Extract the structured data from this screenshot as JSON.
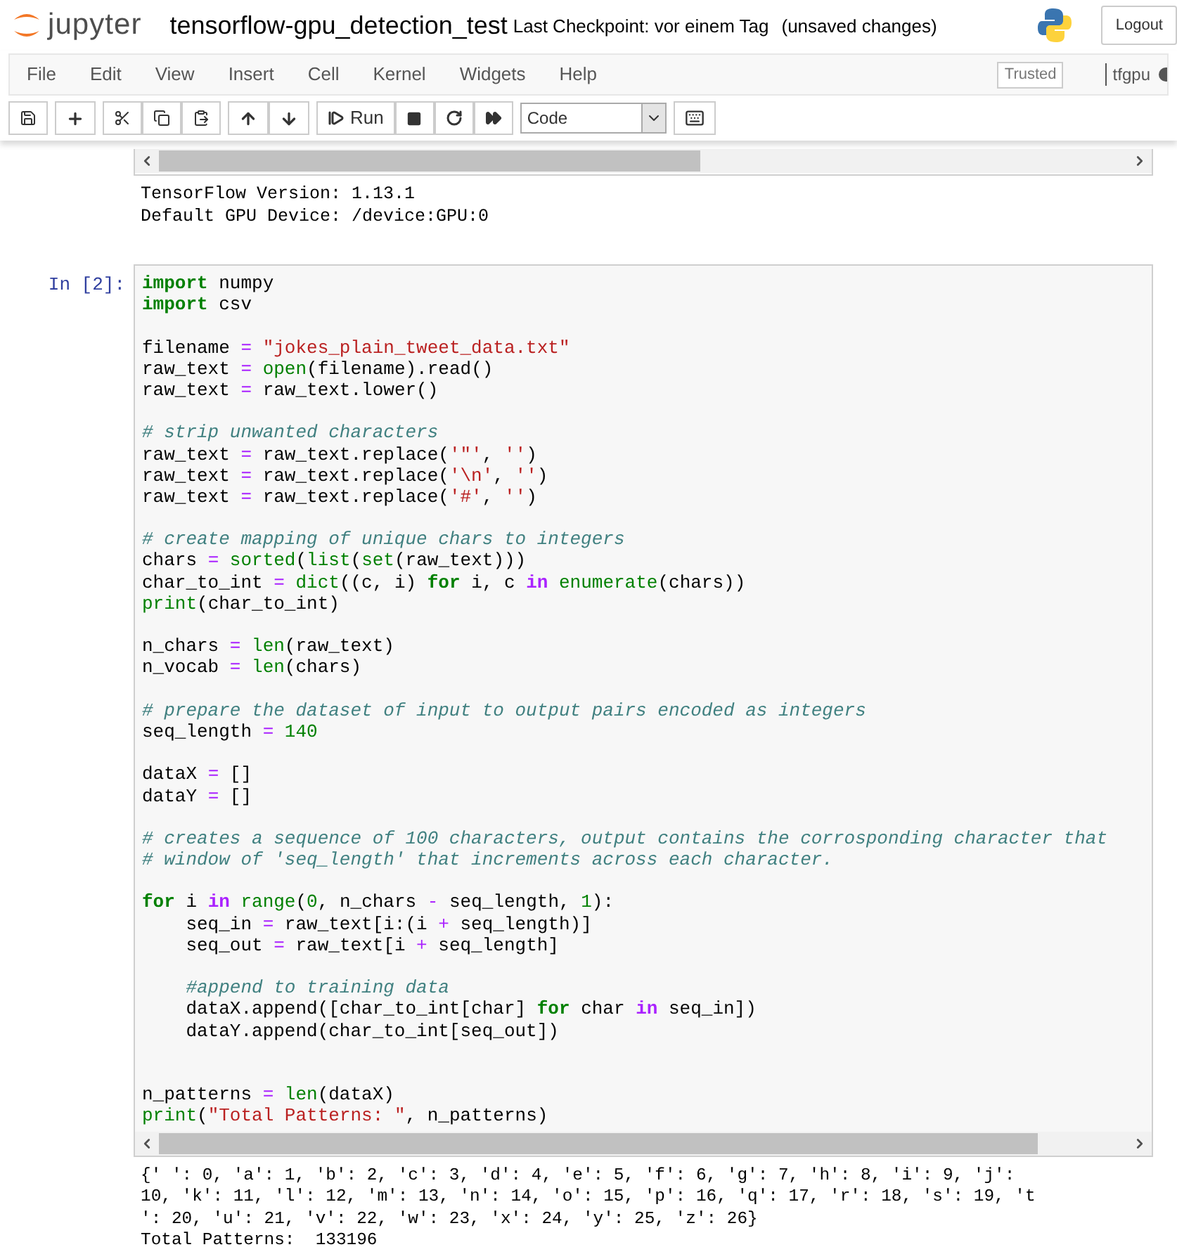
{
  "header": {
    "logo_text": "jupyter",
    "notebook_name": "tensorflow-gpu_detection_test",
    "checkpoint": "Last Checkpoint: vor einem Tag",
    "unsaved": "(unsaved changes)",
    "logout": "Logout"
  },
  "menubar": {
    "items": [
      "File",
      "Edit",
      "View",
      "Insert",
      "Cell",
      "Kernel",
      "Widgets",
      "Help"
    ],
    "trusted": "Trusted",
    "kernel_name": "tfgpu"
  },
  "toolbar": {
    "run_label": "Run",
    "cell_type": "Code"
  },
  "previous_output": [
    "TensorFlow Version: 1.13.1",
    "Default GPU Device: /device:GPU:0"
  ],
  "cell": {
    "prompt": "In [2]:",
    "blocks": [
      {
        "lines": [
          [
            {
              "kind": "kw",
              "text": "import"
            },
            {
              "kind": "plain",
              "text": " numpy"
            }
          ],
          [
            {
              "kind": "kw",
              "text": "import"
            },
            {
              "kind": "plain",
              "text": " csv"
            }
          ]
        ]
      },
      {
        "lines": [
          [
            {
              "kind": "plain",
              "text": "filename"
            },
            {
              "kind": "op",
              "text": " = "
            },
            {
              "kind": "str",
              "text": "\"jokes_plain_tweet_data.txt\""
            }
          ],
          [
            {
              "kind": "plain",
              "text": "raw_text"
            },
            {
              "kind": "op",
              "text": " = "
            },
            {
              "kind": "builtin",
              "text": "open"
            },
            {
              "kind": "plain",
              "text": "(filename).read()"
            }
          ],
          [
            {
              "kind": "plain",
              "text": "raw_text"
            },
            {
              "kind": "op",
              "text": " = "
            },
            {
              "kind": "plain",
              "text": "raw_text.lower()"
            }
          ]
        ]
      },
      {
        "lines": [
          [
            {
              "kind": "comment",
              "text": "# strip unwanted characters"
            }
          ],
          [
            {
              "kind": "plain",
              "text": "raw_text"
            },
            {
              "kind": "op",
              "text": " = "
            },
            {
              "kind": "plain",
              "text": "raw_text.replace("
            },
            {
              "kind": "str",
              "text": "'\"'"
            },
            {
              "kind": "plain",
              "text": ", "
            },
            {
              "kind": "str",
              "text": "''"
            },
            {
              "kind": "plain",
              "text": ")"
            }
          ],
          [
            {
              "kind": "plain",
              "text": "raw_text"
            },
            {
              "kind": "op",
              "text": " = "
            },
            {
              "kind": "plain",
              "text": "raw_text.replace("
            },
            {
              "kind": "str",
              "text": "'\\n'"
            },
            {
              "kind": "plain",
              "text": ", "
            },
            {
              "kind": "str",
              "text": "''"
            },
            {
              "kind": "plain",
              "text": ")"
            }
          ],
          [
            {
              "kind": "plain",
              "text": "raw_text"
            },
            {
              "kind": "op",
              "text": " = "
            },
            {
              "kind": "plain",
              "text": "raw_text.replace("
            },
            {
              "kind": "str",
              "text": "'#'"
            },
            {
              "kind": "plain",
              "text": ", "
            },
            {
              "kind": "str",
              "text": "''"
            },
            {
              "kind": "plain",
              "text": ")"
            }
          ]
        ]
      },
      {
        "lines": [
          [
            {
              "kind": "comment",
              "text": "# create mapping of unique chars to integers"
            }
          ],
          [
            {
              "kind": "plain",
              "text": "chars"
            },
            {
              "kind": "op",
              "text": " = "
            },
            {
              "kind": "builtin",
              "text": "sorted"
            },
            {
              "kind": "plain",
              "text": "("
            },
            {
              "kind": "builtin",
              "text": "list"
            },
            {
              "kind": "plain",
              "text": "("
            },
            {
              "kind": "builtin",
              "text": "set"
            },
            {
              "kind": "plain",
              "text": "(raw_text)))"
            }
          ],
          [
            {
              "kind": "plain",
              "text": "char_to_int"
            },
            {
              "kind": "op",
              "text": " = "
            },
            {
              "kind": "builtin",
              "text": "dict"
            },
            {
              "kind": "plain",
              "text": "((c, i) "
            },
            {
              "kind": "kw",
              "text": "for"
            },
            {
              "kind": "plain",
              "text": " i, c "
            },
            {
              "kind": "opword",
              "text": "in"
            },
            {
              "kind": "builtin",
              "text": " enumerate"
            },
            {
              "kind": "plain",
              "text": "(chars))"
            }
          ],
          [
            {
              "kind": "builtin",
              "text": "print"
            },
            {
              "kind": "plain",
              "text": "(char_to_int)"
            }
          ]
        ]
      },
      {
        "lines": [
          [
            {
              "kind": "plain",
              "text": "n_chars"
            },
            {
              "kind": "op",
              "text": " = "
            },
            {
              "kind": "builtin",
              "text": "len"
            },
            {
              "kind": "plain",
              "text": "(raw_text)"
            }
          ],
          [
            {
              "kind": "plain",
              "text": "n_vocab"
            },
            {
              "kind": "op",
              "text": " = "
            },
            {
              "kind": "builtin",
              "text": "len"
            },
            {
              "kind": "plain",
              "text": "(chars)"
            }
          ]
        ]
      },
      {
        "lines": [
          [
            {
              "kind": "comment",
              "text": "# prepare the dataset of input to output pairs encoded as integers"
            }
          ],
          [
            {
              "kind": "plain",
              "text": "seq_length"
            },
            {
              "kind": "op",
              "text": " = "
            },
            {
              "kind": "num",
              "text": "140"
            }
          ]
        ]
      },
      {
        "lines": [
          [
            {
              "kind": "plain",
              "text": "dataX"
            },
            {
              "kind": "op",
              "text": " = "
            },
            {
              "kind": "plain",
              "text": "[]"
            }
          ],
          [
            {
              "kind": "plain",
              "text": "dataY"
            },
            {
              "kind": "op",
              "text": " = "
            },
            {
              "kind": "plain",
              "text": "[]"
            }
          ]
        ]
      },
      {
        "lines": [
          [
            {
              "kind": "comment",
              "text": "# creates a sequence of 100 characters, output contains the corrosponding character that"
            }
          ],
          [
            {
              "kind": "comment",
              "text": "# window of 'seq_length' that increments across each character."
            }
          ]
        ]
      },
      {
        "lines": [
          [
            {
              "kind": "kw",
              "text": "for"
            },
            {
              "kind": "plain",
              "text": " i "
            },
            {
              "kind": "opword",
              "text": "in"
            },
            {
              "kind": "builtin",
              "text": " range"
            },
            {
              "kind": "plain",
              "text": "("
            },
            {
              "kind": "num",
              "text": "0"
            },
            {
              "kind": "plain",
              "text": ", n_chars"
            },
            {
              "kind": "op",
              "text": " - "
            },
            {
              "kind": "plain",
              "text": "seq_length, "
            },
            {
              "kind": "num",
              "text": "1"
            },
            {
              "kind": "plain",
              "text": "):"
            }
          ],
          [
            {
              "kind": "plain",
              "text": "    seq_in"
            },
            {
              "kind": "op",
              "text": " = "
            },
            {
              "kind": "plain",
              "text": "raw_text[i:(i"
            },
            {
              "kind": "op",
              "text": " + "
            },
            {
              "kind": "plain",
              "text": "seq_length)]"
            }
          ],
          [
            {
              "kind": "plain",
              "text": "    seq_out"
            },
            {
              "kind": "op",
              "text": " = "
            },
            {
              "kind": "plain",
              "text": "raw_text[i"
            },
            {
              "kind": "op",
              "text": " + "
            },
            {
              "kind": "plain",
              "text": "seq_length]"
            }
          ]
        ]
      },
      {
        "lines": [
          [
            {
              "kind": "comment",
              "text": "    #append to training data"
            }
          ],
          [
            {
              "kind": "plain",
              "text": "    dataX.append([char_to_int[char] "
            },
            {
              "kind": "kw",
              "text": "for"
            },
            {
              "kind": "plain",
              "text": " char "
            },
            {
              "kind": "opword",
              "text": "in"
            },
            {
              "kind": "plain",
              "text": " seq_in])"
            }
          ],
          [
            {
              "kind": "plain",
              "text": "    dataY.append(char_to_int[seq_out])"
            }
          ]
        ]
      },
      {
        "double_gap_before": true,
        "lines": [
          [
            {
              "kind": "plain",
              "text": "n_patterns"
            },
            {
              "kind": "op",
              "text": " = "
            },
            {
              "kind": "builtin",
              "text": "len"
            },
            {
              "kind": "plain",
              "text": "(dataX)"
            }
          ],
          [
            {
              "kind": "builtin",
              "text": "print"
            },
            {
              "kind": "plain",
              "text": "("
            },
            {
              "kind": "str",
              "text": "\"Total Patterns: \""
            },
            {
              "kind": "plain",
              "text": ", n_patterns)"
            }
          ]
        ]
      }
    ],
    "output": [
      "{' ': 0, 'a': 1, 'b': 2, 'c': 3, 'd': 4, 'e': 5, 'f': 6, 'g': 7, 'h': 8, 'i': 9, 'j':",
      "10, 'k': 11, 'l': 12, 'm': 13, 'n': 14, 'o': 15, 'p': 16, 'q': 17, 'r': 18, 's': 19, 't",
      "': 20, 'u': 21, 'v': 22, 'w': 23, 'x': 24, 'y': 25, 'z': 26}",
      "Total Patterns:  133196"
    ]
  }
}
